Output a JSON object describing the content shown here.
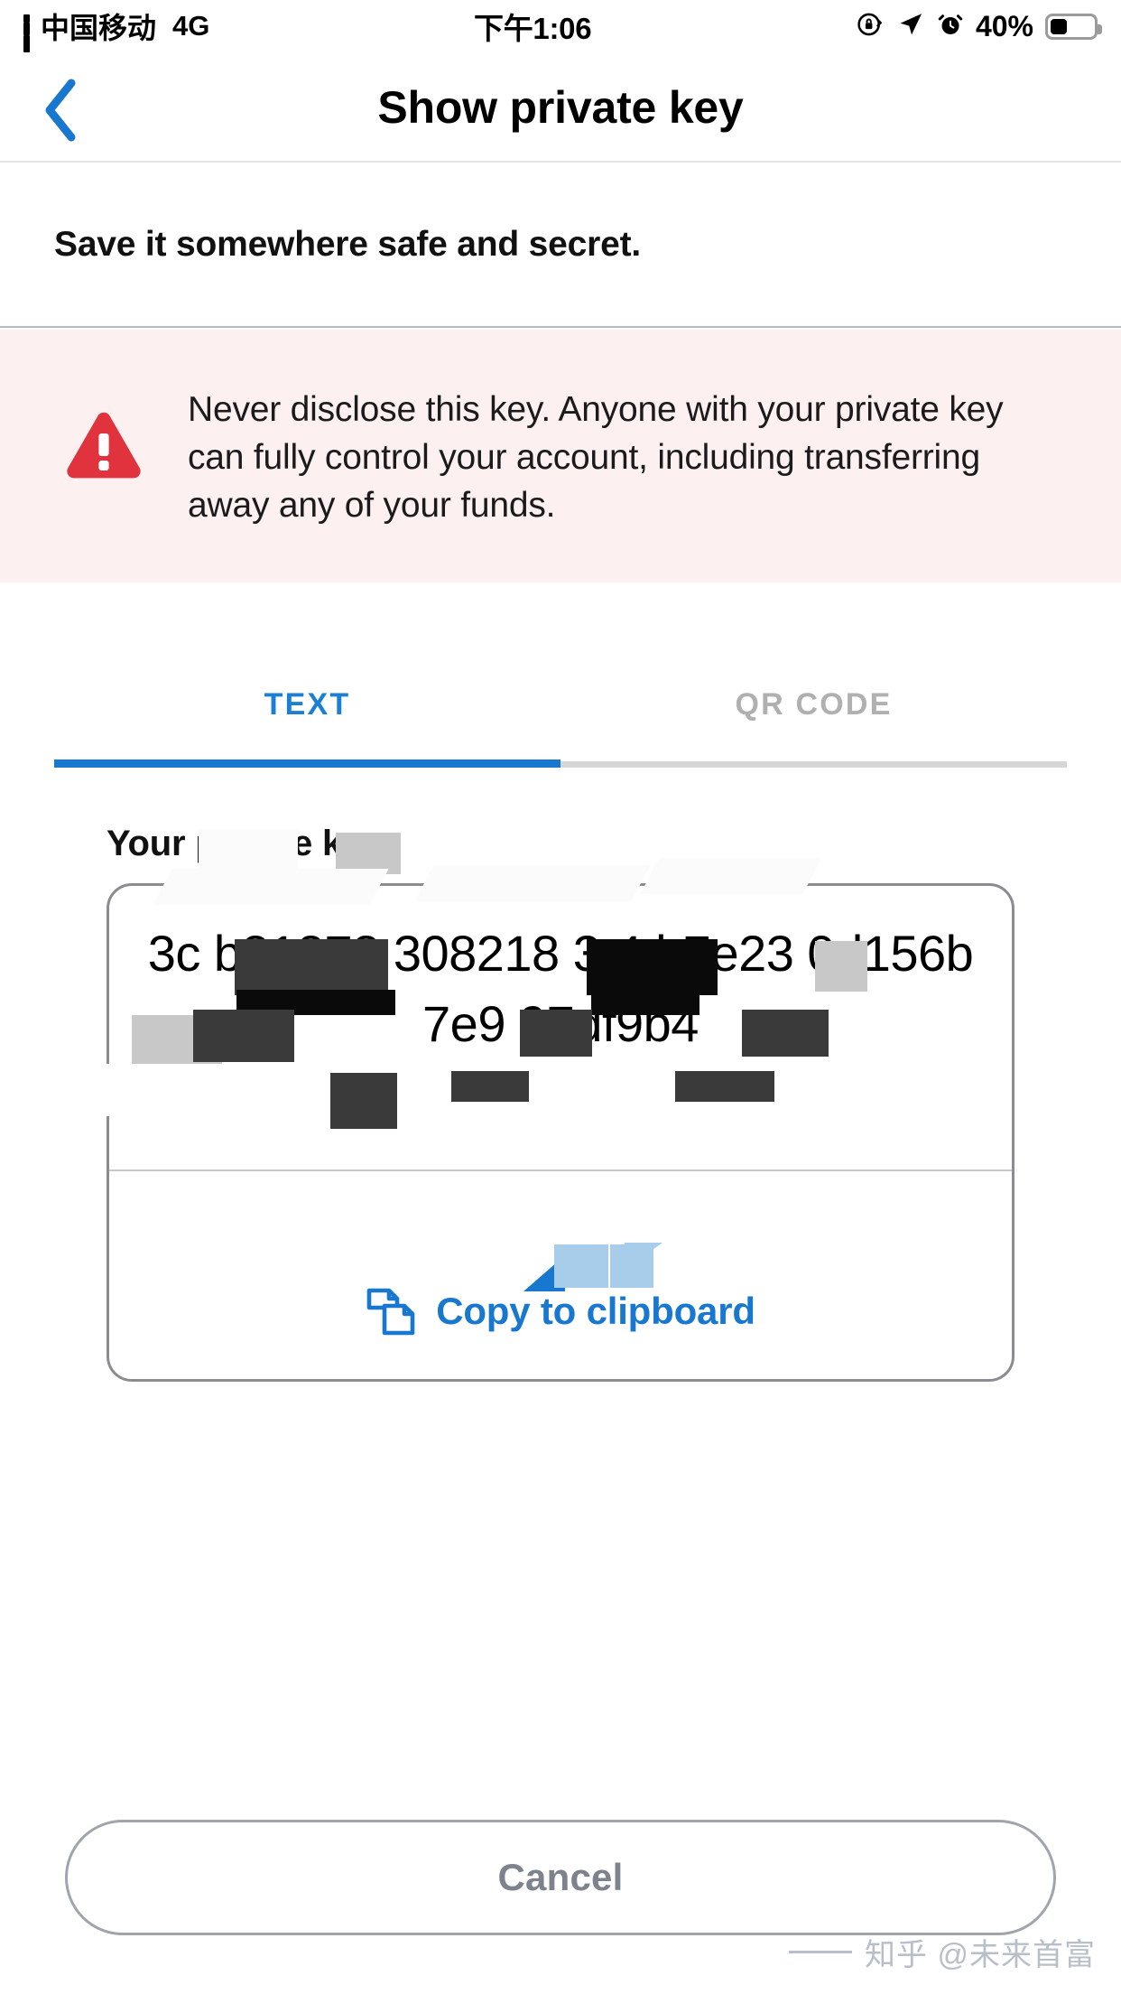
{
  "status_bar": {
    "carrier": "中国移动",
    "network": "4G",
    "time": "下午1:06",
    "battery_percent": "40%",
    "battery_level": 40,
    "icons": [
      "signal-bars-icon",
      "rotation-lock-icon",
      "location-arrow-icon",
      "alarm-clock-icon",
      "battery-icon"
    ]
  },
  "navbar": {
    "back_icon": "chevron-left-icon",
    "title": "Show private key",
    "accent_color": "#1878cf"
  },
  "subtitle": "Save it somewhere safe and secret.",
  "warning": {
    "icon": "warning-triangle-icon",
    "icon_color": "#e03131",
    "background_color": "#fcf0f1",
    "text": "Never disclose this key. Anyone with your private key can fully control your account, including transferring away any of your funds."
  },
  "tabs": [
    {
      "label": "TEXT",
      "active": true
    },
    {
      "label": "QR CODE",
      "active": false
    }
  ],
  "key_section": {
    "label": "Your private key",
    "value": "3c     b81878    308218     3  4    b7e23   0d156b    7e9        97df9b4",
    "copy_button": {
      "icon": "copy-pages-icon",
      "label": "Copy to clipboard",
      "color": "#1878cf"
    }
  },
  "cancel_button": {
    "label": "Cancel",
    "text_color": "#7d828c"
  },
  "watermark": "知乎 @未来首富"
}
